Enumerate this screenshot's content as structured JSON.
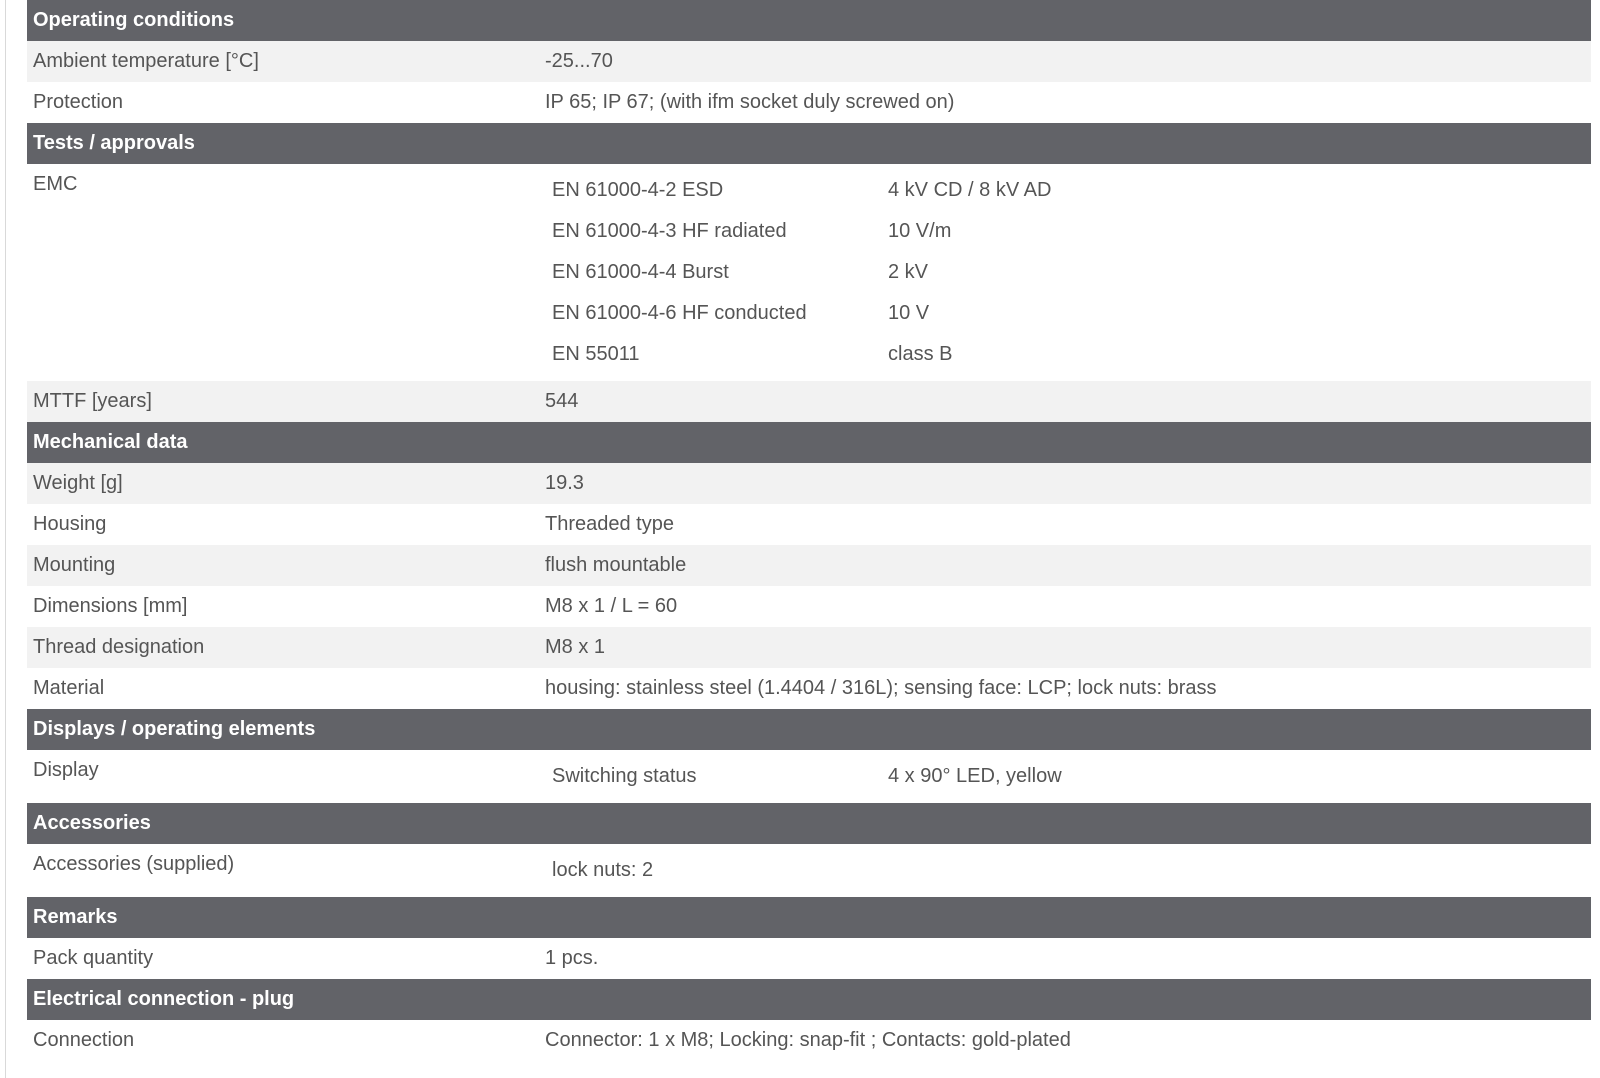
{
  "sections": {
    "operating": {
      "title": "Operating conditions",
      "rows": [
        {
          "label": "Ambient temperature [°C]",
          "value": "-25...70"
        },
        {
          "label": "Protection",
          "value": "IP 65; IP 67; (with ifm socket duly screwed on)"
        }
      ]
    },
    "tests": {
      "title": "Tests / approvals",
      "emc": {
        "label": "EMC",
        "items": [
          {
            "name": "EN 61000-4-2 ESD",
            "value": "4 kV CD / 8 kV AD"
          },
          {
            "name": "EN 61000-4-3 HF radiated",
            "value": "10 V/m"
          },
          {
            "name": "EN 61000-4-4 Burst",
            "value": "2 kV"
          },
          {
            "name": "EN 61000-4-6 HF conducted",
            "value": "10 V"
          },
          {
            "name": "EN 55011",
            "value": "class B"
          }
        ]
      },
      "mttf": {
        "label": "MTTF [years]",
        "value": "544"
      }
    },
    "mechanical": {
      "title": "Mechanical data",
      "rows": [
        {
          "label": "Weight [g]",
          "value": "19.3"
        },
        {
          "label": "Housing",
          "value": "Threaded type"
        },
        {
          "label": "Mounting",
          "value": "flush mountable"
        },
        {
          "label": "Dimensions [mm]",
          "value": "M8 x 1 / L = 60"
        },
        {
          "label": "Thread designation",
          "value": "M8 x 1"
        },
        {
          "label": "Material",
          "value": "housing: stainless steel (1.4404 / 316L); sensing face: LCP; lock nuts: brass"
        }
      ]
    },
    "displays": {
      "title": "Displays / operating elements",
      "display": {
        "label": "Display",
        "items": [
          {
            "name": "Switching status",
            "value": "4 x 90° LED, yellow"
          }
        ]
      }
    },
    "accessories": {
      "title": "Accessories",
      "supplied": {
        "label": "Accessories (supplied)",
        "value": "lock nuts: 2"
      }
    },
    "remarks": {
      "title": "Remarks",
      "rows": [
        {
          "label": "Pack quantity",
          "value": "1 pcs."
        }
      ]
    },
    "electrical": {
      "title": "Electrical connection - plug",
      "rows": [
        {
          "label": "Connection",
          "value": "Connector: 1 x M8; Locking: snap-fit ; Contacts: gold-plated"
        }
      ]
    }
  },
  "colors": {
    "header_bg": "#626368",
    "header_text": "#ffffff",
    "row_alt_bg": "#f2f2f2",
    "text": "#555555"
  }
}
